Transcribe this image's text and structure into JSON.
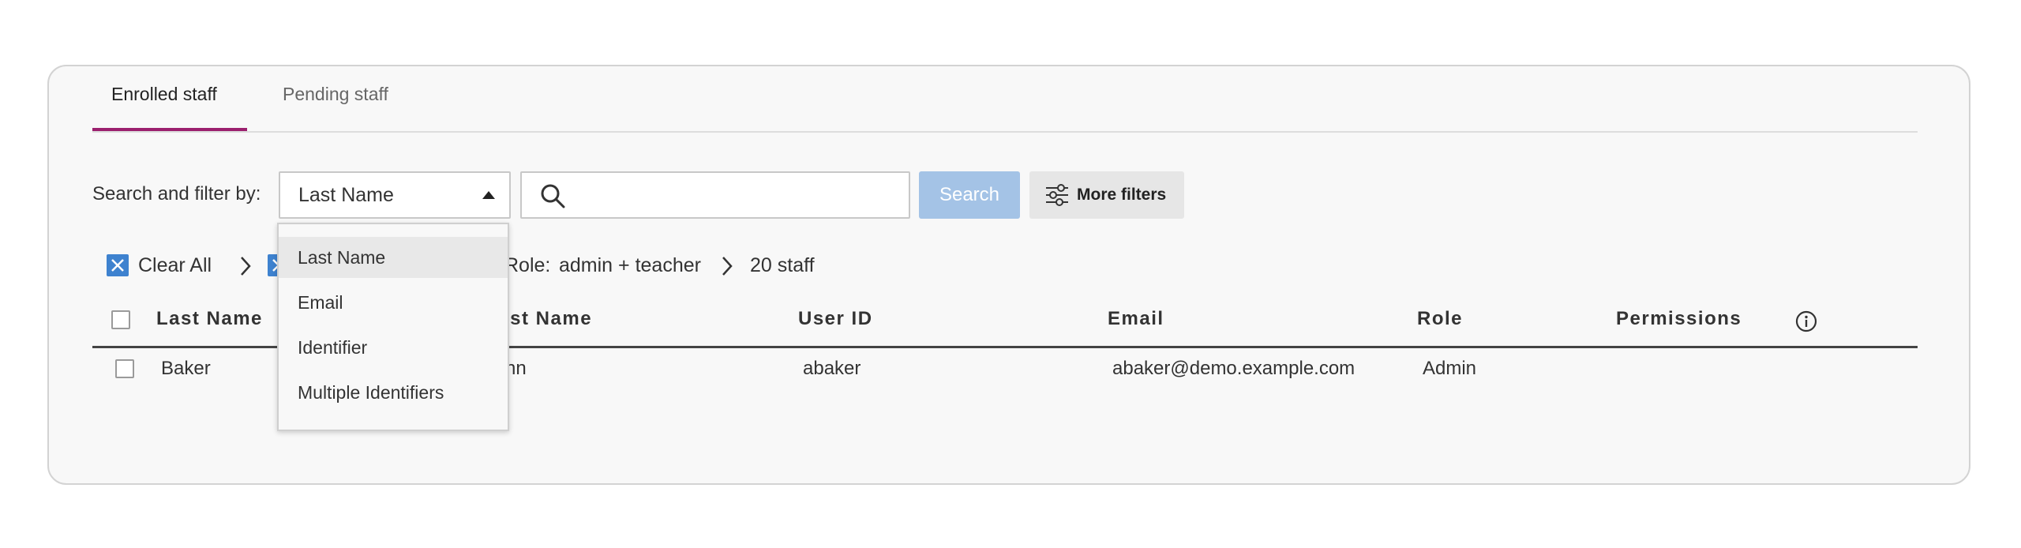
{
  "tabs": [
    {
      "label": "Enrolled staff",
      "active": true
    },
    {
      "label": "Pending staff",
      "active": false
    }
  ],
  "filter": {
    "label": "Search and filter by:",
    "selected": "Last Name",
    "options": [
      "Last Name",
      "Email",
      "Identifier",
      "Multiple Identifiers"
    ]
  },
  "search": {
    "value": "",
    "button_label": "Search"
  },
  "more_filters": {
    "label": "More filters"
  },
  "chips": {
    "clear_all": "Clear All",
    "role_label": "Role:",
    "role_value": "admin + teacher",
    "result_count": "20 staff"
  },
  "table": {
    "columns": [
      "Last Name",
      "First Name",
      "User ID",
      "Email",
      "Role",
      "Permissions"
    ],
    "rows": [
      {
        "last_name": "Baker",
        "first_name": "Ann",
        "user_id": "abaker",
        "email": "abaker@demo.example.com",
        "role": "Admin"
      }
    ]
  },
  "colors": {
    "tab_accent": "#9b1f6e",
    "search_button": "#a4c3e6",
    "chip_x": "#3e82cf"
  },
  "icons": [
    "search-icon",
    "sliders-icon",
    "close-icon",
    "chevron-right-icon",
    "info-icon",
    "caret-up-icon"
  ]
}
